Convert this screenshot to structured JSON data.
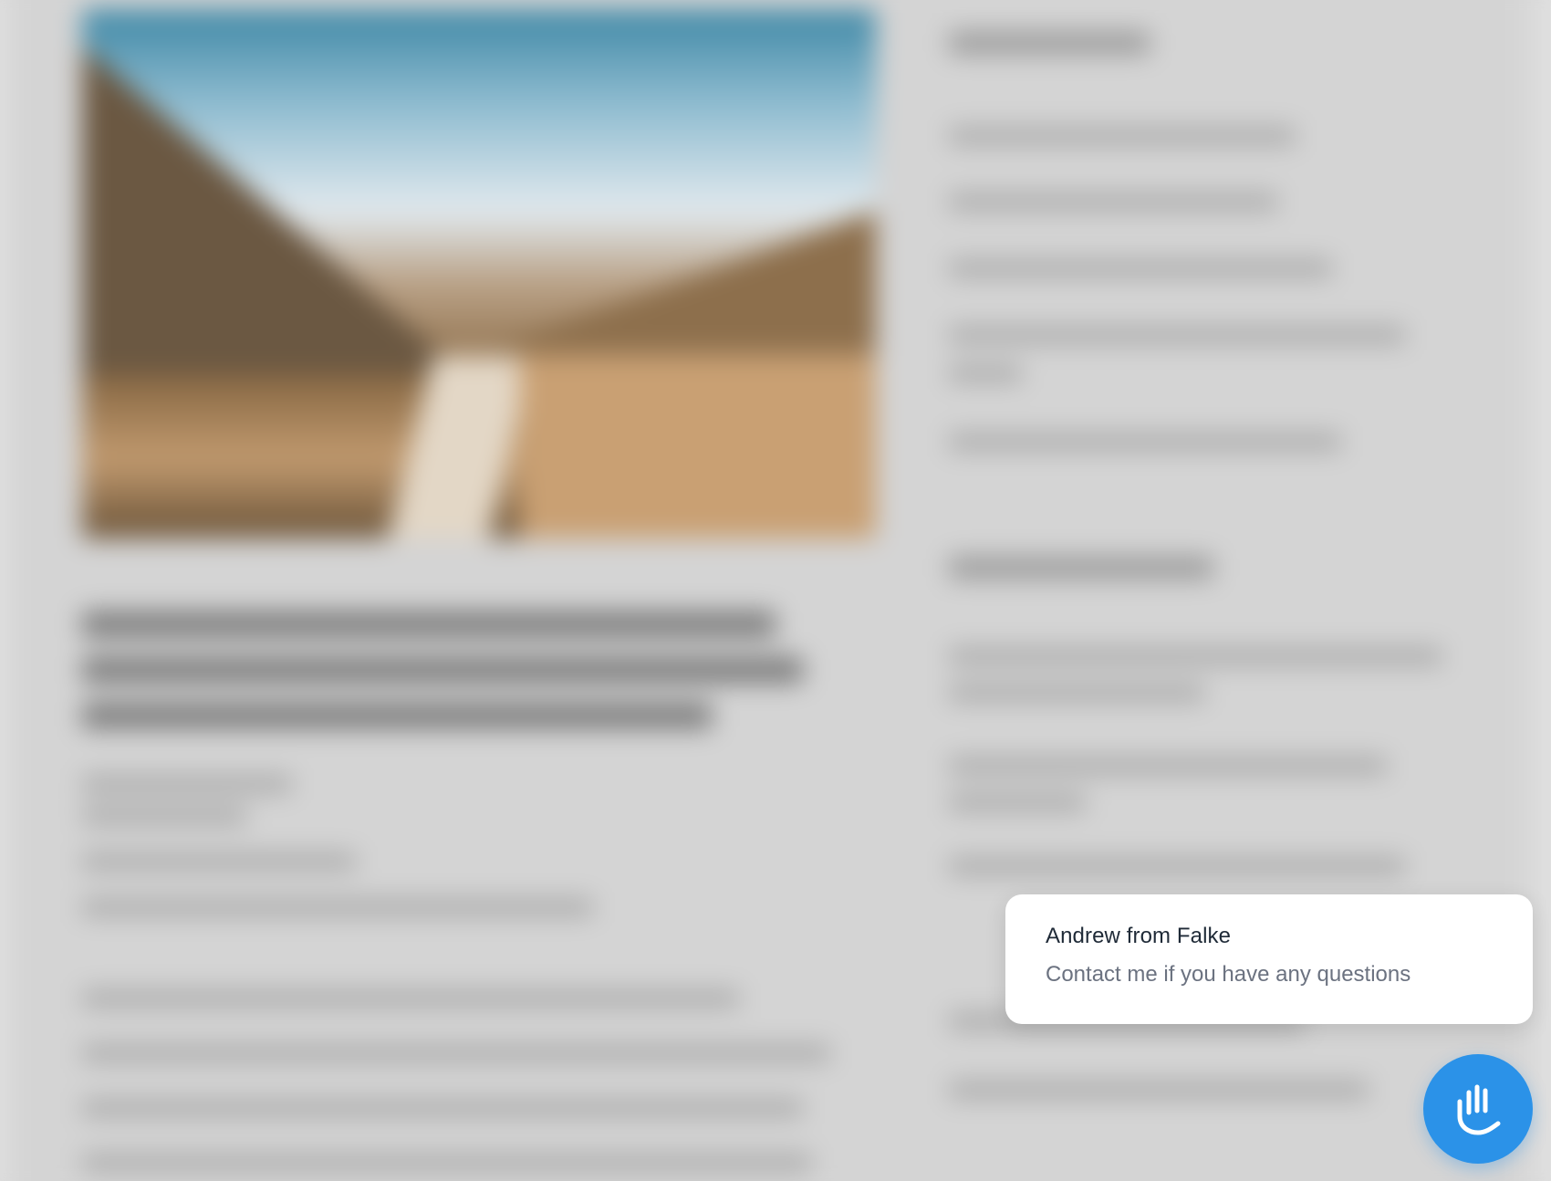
{
  "chat_widget": {
    "agent_name": "Andrew from Falke",
    "message": "Contact me if you have any questions",
    "launcher_icon": "hand-wave-icon",
    "accent_color": "#2b92e8"
  },
  "background": {
    "state": "blurred"
  }
}
